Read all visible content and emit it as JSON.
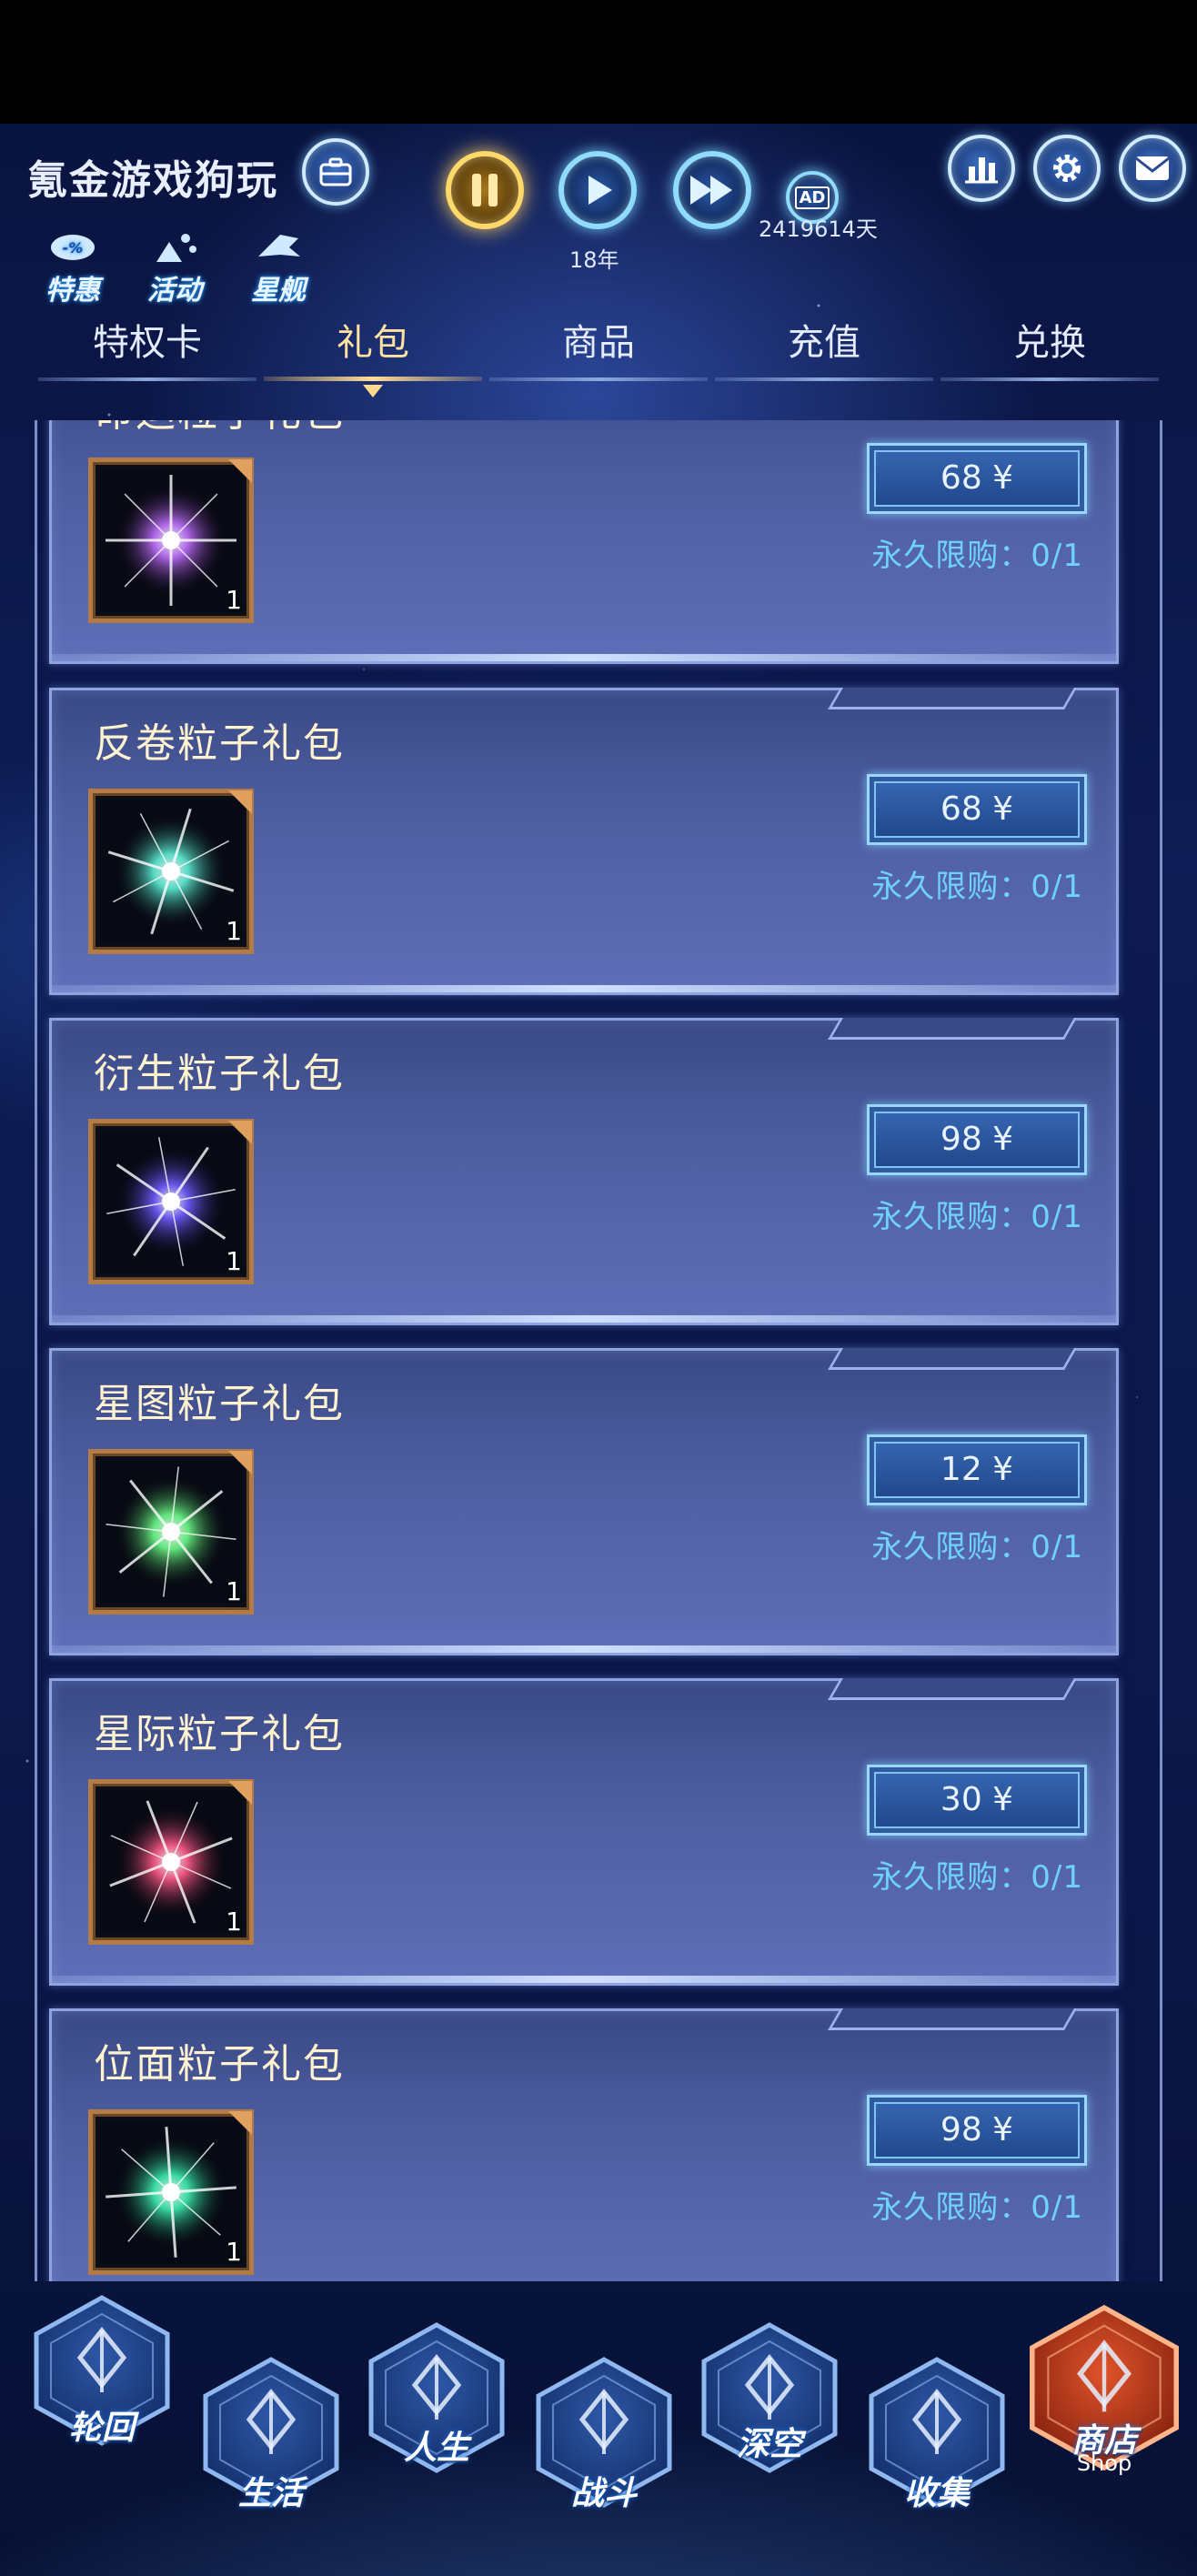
{
  "header": {
    "title": "氪金游戏狗玩",
    "year_label": "18年",
    "days_label": "2419614天",
    "ad_badge": "AD",
    "quick": [
      {
        "label": "特惠",
        "icon": "discount-icon"
      },
      {
        "label": "活动",
        "icon": "activity-icon"
      },
      {
        "label": "星舰",
        "icon": "starship-icon"
      }
    ],
    "right_icons": [
      "rank-icon",
      "gear-icon",
      "mail-icon"
    ]
  },
  "tabs": [
    {
      "label": "特权卡",
      "active": false
    },
    {
      "label": "礼包",
      "active": true
    },
    {
      "label": "商品",
      "active": false
    },
    {
      "label": "充值",
      "active": false
    },
    {
      "label": "兑换",
      "active": false
    }
  ],
  "packages": [
    {
      "name": "命运粒子礼包",
      "price": "68 ¥",
      "limit": "永久限购：0/1",
      "qty": "1",
      "icon": "fate-particle-icon",
      "color": "#c070ff"
    },
    {
      "name": "反卷粒子礼包",
      "price": "68 ¥",
      "limit": "永久限购：0/1",
      "qty": "1",
      "icon": "anti-curl-particle-icon",
      "color": "#5ff0d8"
    },
    {
      "name": "衍生粒子礼包",
      "price": "98 ¥",
      "limit": "永久限购：0/1",
      "qty": "1",
      "icon": "derivative-particle-icon",
      "color": "#6f5cff"
    },
    {
      "name": "星图粒子礼包",
      "price": "12 ¥",
      "limit": "永久限购：0/1",
      "qty": "1",
      "icon": "star-map-particle-icon",
      "color": "#6dff8a"
    },
    {
      "name": "星际粒子礼包",
      "price": "30 ¥",
      "limit": "永久限购：0/1",
      "qty": "1",
      "icon": "interstellar-particle-icon",
      "color": "#ff5a8a"
    },
    {
      "name": "位面粒子礼包",
      "price": "98 ¥",
      "limit": "永久限购：0/1",
      "qty": "1",
      "icon": "plane-particle-icon",
      "color": "#3df0b0"
    }
  ],
  "bottom_nav": [
    {
      "label": "轮回",
      "icon": "reincarnation-icon",
      "active": false
    },
    {
      "label": "生活",
      "icon": "life-icon",
      "active": false
    },
    {
      "label": "人生",
      "icon": "lifetime-icon",
      "active": false
    },
    {
      "label": "战斗",
      "icon": "battle-icon",
      "active": false
    },
    {
      "label": "深空",
      "icon": "deep-space-icon",
      "active": false
    },
    {
      "label": "收集",
      "icon": "collect-icon",
      "active": false
    },
    {
      "label": "商店",
      "sub": "Shop",
      "icon": "shop-icon",
      "active": true
    }
  ],
  "colors": {
    "accent_gold": "#ffd86a",
    "accent_cyan": "#6fd1ff",
    "card_bg": "#4d5da0",
    "shop_orange": "#e0532a"
  }
}
